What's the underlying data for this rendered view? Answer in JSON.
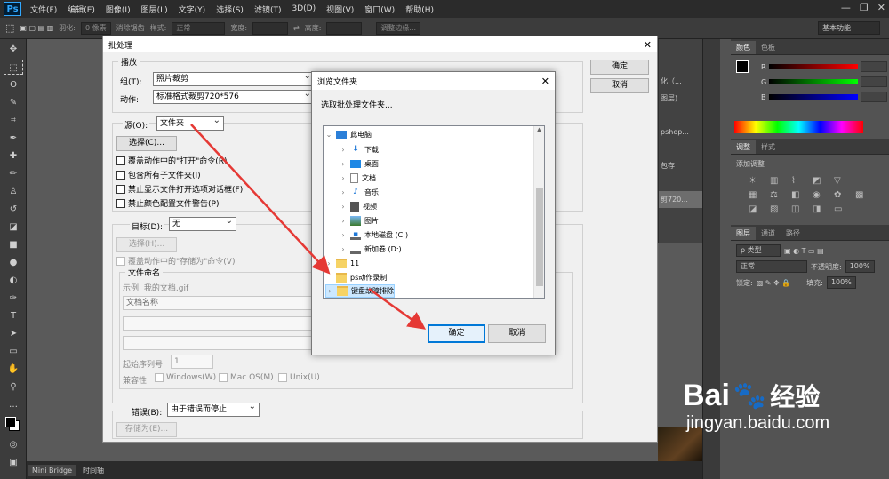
{
  "menubar": {
    "logo": "Ps",
    "items": [
      "文件(F)",
      "编辑(E)",
      "图像(I)",
      "图层(L)",
      "文字(Y)",
      "选择(S)",
      "滤镜(T)",
      "3D(D)",
      "视图(V)",
      "窗口(W)",
      "帮助(H)"
    ],
    "window_controls": [
      "—",
      "❐",
      "✕"
    ]
  },
  "options": {
    "feather_label": "羽化:",
    "feather_value": "0 像素",
    "antialias": "消除锯齿",
    "style_label": "样式:",
    "style_value": "正常",
    "width_label": "宽度:",
    "height_label": "高度:",
    "refine_button": "调整边缘...",
    "workspace": "基本功能"
  },
  "history_strip": [
    "",
    "",
    "化（...",
    "图层)",
    "",
    "pshop...",
    "",
    "包存",
    "",
    "剪720...",
    ""
  ],
  "panels": {
    "color_tabs": [
      "颜色",
      "色板"
    ],
    "rgb": [
      "R",
      "G",
      "B"
    ],
    "adjust_tabs": [
      "调整",
      "样式"
    ],
    "adjust_hint": "添加调整",
    "layer_tabs": [
      "图层",
      "通道",
      "路径"
    ],
    "kind": "ρ 类型",
    "blend": "正常",
    "opacity_label": "不透明度:",
    "opacity_value": "100%",
    "lock_label": "锁定:",
    "fill_label": "填充:",
    "fill_value": "100%"
  },
  "bottom_tabs": [
    "Mini Bridge",
    "时间轴"
  ],
  "batch": {
    "title": "批处理",
    "play_group": "播放",
    "set_label": "组(T):",
    "set_value": "照片裁剪",
    "action_label": "动作:",
    "action_value": "标准格式裁剪720*576",
    "source_label": "源(O):",
    "source_value": "文件夹",
    "choose_button": "选择(C)...",
    "source_checks": [
      "覆盖动作中的\"打开\"命令(R)",
      "包含所有子文件夹(I)",
      "禁止显示文件打开选项对话框(F)",
      "禁止颜色配置文件警告(P)"
    ],
    "dest_label": "目标(D):",
    "dest_value": "无",
    "dest_choose": "选择(H)...",
    "dest_check": "覆盖动作中的\"存储为\"命令(V)",
    "naming_group": "文件命名",
    "example": "示例: 我的文档.gif",
    "name_field": "文档名称",
    "start_serial_label": "起始序列号:",
    "start_serial_value": "1",
    "compat_label": "兼容性:",
    "compat": [
      "Windows(W)",
      "Mac OS(M)",
      "Unix(U)"
    ],
    "errors_label": "错误(B):",
    "errors_value": "由于错误而停止",
    "save_as": "存储为(E)...",
    "ok": "确定",
    "cancel": "取消"
  },
  "browse": {
    "title": "浏览文件夹",
    "prompt": "选取批处理文件夹...",
    "tree": [
      {
        "label": "此电脑",
        "icon": "pc"
      },
      {
        "label": "下载",
        "icon": "download"
      },
      {
        "label": "桌面",
        "icon": "desktop"
      },
      {
        "label": "文档",
        "icon": "doc"
      },
      {
        "label": "音乐",
        "icon": "music"
      },
      {
        "label": "视频",
        "icon": "video"
      },
      {
        "label": "图片",
        "icon": "picture"
      },
      {
        "label": "本地磁盘 (C:)",
        "icon": "drive"
      },
      {
        "label": "新加卷 (D:)",
        "icon": "drive"
      },
      {
        "label": "11",
        "icon": "folder"
      },
      {
        "label": "ps动作录制",
        "icon": "folder"
      },
      {
        "label": "键盘故障排除",
        "icon": "folder"
      }
    ],
    "ok": "确定",
    "cancel": "取消"
  },
  "watermark": {
    "brand": "Bai",
    "brand2": "经验",
    "url": "jingyan.baidu.com"
  },
  "colors": {
    "accent": "#0078d7",
    "arrow": "#e53935",
    "ps_blue": "#31a8ff"
  }
}
